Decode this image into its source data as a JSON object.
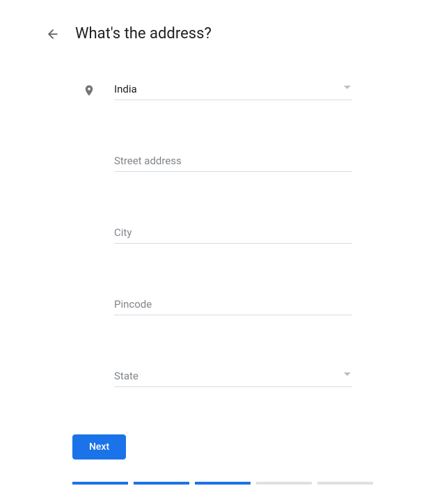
{
  "header": {
    "title": "What's the address?"
  },
  "form": {
    "country": {
      "value": "India"
    },
    "street": {
      "placeholder": "Street address",
      "value": ""
    },
    "city": {
      "placeholder": "City",
      "value": ""
    },
    "pincode": {
      "placeholder": "Pincode",
      "value": ""
    },
    "state": {
      "placeholder": "State",
      "value": ""
    }
  },
  "footer": {
    "next_label": "Next"
  },
  "progress": {
    "completed": 3,
    "total": 5
  }
}
